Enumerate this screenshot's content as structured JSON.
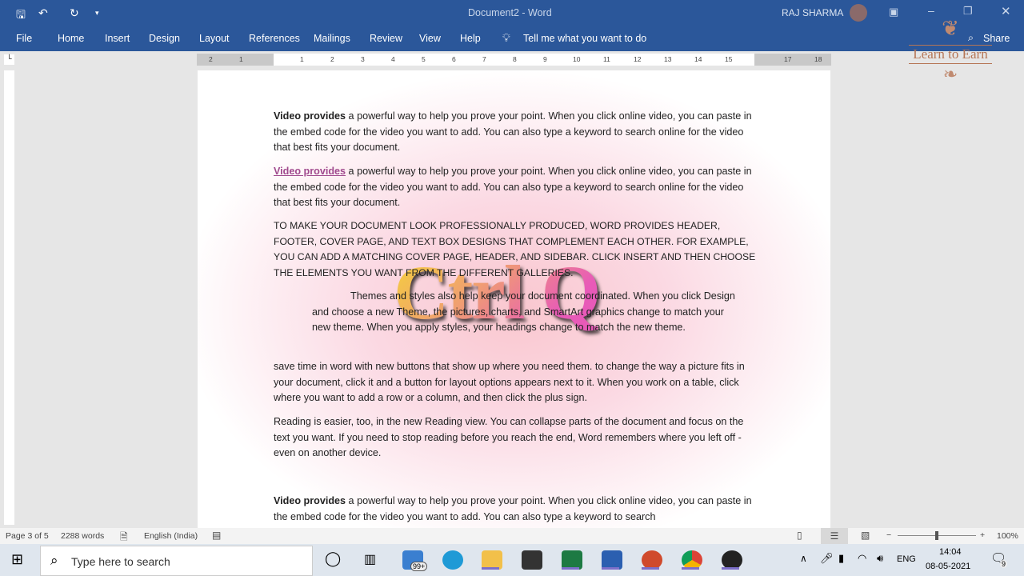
{
  "window": {
    "title": "Document2  -  Word",
    "user": "RAJ SHARMA",
    "share": "Share"
  },
  "ribbon": {
    "tabs": [
      "File",
      "Home",
      "Insert",
      "Design",
      "Layout",
      "References",
      "Mailings",
      "Review",
      "View",
      "Help"
    ],
    "tell_me": "Tell me what you want to do"
  },
  "watermark": {
    "logo_text": "Learn to Earn",
    "overlay": "Ctrl Q"
  },
  "ruler": {
    "labels": [
      "2",
      "1",
      "1",
      "2",
      "3",
      "4",
      "5",
      "6",
      "7",
      "8",
      "9",
      "10",
      "11",
      "12",
      "13",
      "14",
      "15",
      "17",
      "18"
    ]
  },
  "document": {
    "p1_bold": "Video provides",
    "p1_rest": " a powerful way to help you prove your point. When you click online video, you can paste in the embed code for the video you want to add. You can also type a keyword to search online for the video that best fits your document.",
    "p2_link": "Video provides",
    "p2_rest": " a powerful way to help you prove your point. When you click online video, you can paste in the embed code for the video you want to add. You can also type a keyword to search online for the video that best fits your document.",
    "p3": "TO MAKE YOUR DOCUMENT LOOK PROFESSIONALLY PRODUCED, WORD PROVIDES HEADER, FOOTER, COVER PAGE, AND TEXT BOX DESIGNS THAT COMPLEMENT EACH OTHER. FOR EXAMPLE, YOU CAN ADD A MATCHING COVER PAGE, HEADER, AND SIDEBAR. CLICK INSERT AND THEN CHOOSE THE ELEMENTS YOU WANT FROM THE DIFFERENT GALLERIES.",
    "p4": "Themes and styles also help keep your document coordinated. When you click Design and choose a new Theme, the pictures, charts, and SmartArt graphics change to match your new theme. When you apply styles, your headings change to match the new theme.",
    "p5": "save time in word with new buttons that show up where you need them. to change the way a picture fits in your document, click it and a button for layout options appears next to it. When you work on a table, click where you want to add a row or a column, and then click the plus sign.",
    "p6": "Reading is easier, too, in the new Reading view. You can collapse parts of the document and focus on the text you want. If you need to stop reading before you reach the end, Word remembers where you left off - even on another device.",
    "p7_bold": "Video provides",
    "p7_rest": " a powerful way to help you prove your point. When you click online video, you can paste in the embed code for the video you want to add. You can also type a keyword to search"
  },
  "status": {
    "page": "Page 3 of 5",
    "words": "2288 words",
    "language": "English (India)",
    "zoom": "100%",
    "zoom_level": 100
  },
  "taskbar": {
    "search_placeholder": "Type here to search",
    "mail_badge": "99+",
    "lang": "ENG",
    "time": "14:04",
    "date": "08-05-2021",
    "notifications": "9"
  },
  "colors": {
    "accent": "#2b579a"
  }
}
